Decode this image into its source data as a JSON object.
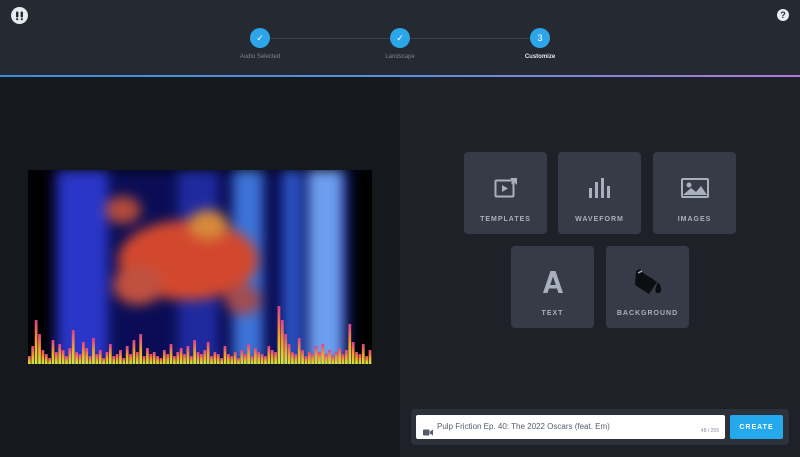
{
  "header": {
    "logo_icon": "app-logo-icon",
    "help_label": "?",
    "steps": [
      {
        "number": "✓",
        "label": "Audio Selected",
        "state": "done"
      },
      {
        "number": "✓",
        "label": "Landscape",
        "state": "done"
      },
      {
        "number": "3",
        "label": "Customize",
        "state": "active"
      }
    ]
  },
  "tools": [
    {
      "label": "TEMPLATES",
      "icon": "templates-icon"
    },
    {
      "label": "WAVEFORM",
      "icon": "waveform-icon"
    },
    {
      "label": "IMAGES",
      "icon": "images-icon"
    },
    {
      "label": "TEXT",
      "icon": "text-icon"
    },
    {
      "label": "BACKGROUND",
      "icon": "paint-bucket-icon"
    }
  ],
  "project": {
    "title_value": "Pulp Friction Ep. 40: The 2022 Oscars (feat. Em)",
    "char_count": "48 / 255",
    "create_label": "CREATE"
  },
  "colors": {
    "accent": "#2ca6e8",
    "topbar": "#252932",
    "tile": "#363b47"
  }
}
